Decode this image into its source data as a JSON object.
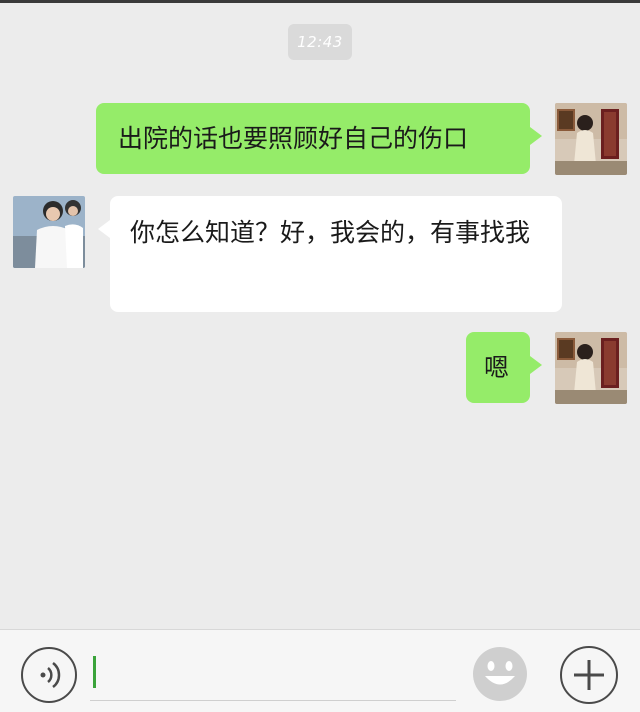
{
  "timestamp": "12:43",
  "messages": [
    {
      "side": "sent",
      "text": "出院的话也要照顾好自己的伤口",
      "avatar": "girl-photo-avatar"
    },
    {
      "side": "received",
      "text": "你怎么知道？好，我会的，有事找我",
      "avatar": "boys-photo-avatar"
    },
    {
      "side": "sent",
      "text": "嗯",
      "avatar": "girl-photo-avatar"
    }
  ],
  "input_bar": {
    "voice_icon": "voice-icon",
    "emoji_icon": "emoji-icon",
    "plus_icon": "plus-icon",
    "value": ""
  },
  "colors": {
    "background": "#ececec",
    "sent_bubble": "#95ec69",
    "received_bubble": "#ffffff",
    "caret": "#3aa33a"
  }
}
